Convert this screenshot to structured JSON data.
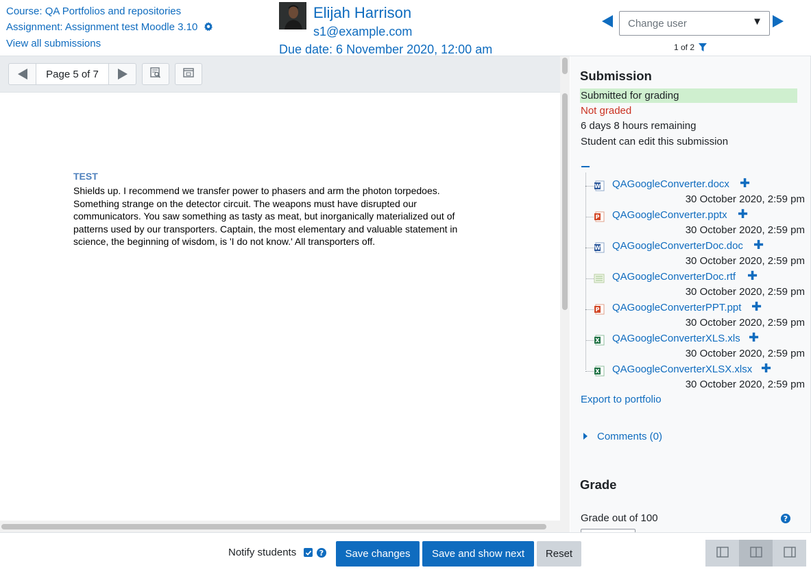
{
  "header": {
    "course_link": "Course: QA Portfolios and repositories",
    "assignment_link": "Assignment: Assignment test Moodle 3.10",
    "view_all": "View all submissions",
    "user_name": "Elijah Harrison",
    "user_email": "s1@example.com",
    "due_date": "Due date: 6 November 2020, 12:00 am",
    "change_user_placeholder": "Change user",
    "user_count": "1 of 2"
  },
  "review": {
    "page_indicator": "Page 5 of 7",
    "doc_title": "TEST",
    "doc_text": "Shields up. I recommend we transfer power to phasers and arm the photon torpedoes. Something strange on the detector circuit. The weapons must have disrupted our communicators. You saw something as tasty as meat, but inorganically materialized out of patterns used by our transporters. Captain, the most elementary and valuable statement in science, the beginning of wisdom, is 'I do not know.' All transporters off."
  },
  "submission": {
    "heading": "Submission",
    "status_submitted": "Submitted for grading",
    "status_grading": "Not graded",
    "time_remaining": "6 days 8 hours remaining",
    "edit_status": "Student can edit this submission",
    "files": [
      {
        "name": "QAGoogleConverter.docx",
        "date": "30 October 2020, 2:59 pm",
        "icon": "word-icon"
      },
      {
        "name": "QAGoogleConverter.pptx",
        "date": "30 October 2020, 2:59 pm",
        "icon": "powerpoint-icon"
      },
      {
        "name": "QAGoogleConverterDoc.doc",
        "date": "30 October 2020, 2:59 pm",
        "icon": "word-icon"
      },
      {
        "name": "QAGoogleConverterDoc.rtf",
        "date": "30 October 2020, 2:59 pm",
        "icon": "text-document-icon"
      },
      {
        "name": "QAGoogleConverterPPT.ppt",
        "date": "30 October 2020, 2:59 pm",
        "icon": "powerpoint-icon"
      },
      {
        "name": "QAGoogleConverterXLS.xls",
        "date": "30 October 2020, 2:59 pm",
        "icon": "excel-icon"
      },
      {
        "name": "QAGoogleConverterXLSX.xlsx",
        "date": "30 October 2020, 2:59 pm",
        "icon": "excel-icon"
      }
    ],
    "export_link": "Export to portfolio",
    "comments_link": "Comments (0)"
  },
  "grade": {
    "heading": "Grade",
    "grade_out_of": "Grade out of 100"
  },
  "footer": {
    "notify_label": "Notify students",
    "notify_checked": true,
    "save_changes": "Save changes",
    "save_and_next": "Save and show next",
    "reset": "Reset"
  },
  "colors": {
    "link": "#0f6cbf",
    "success_bg": "#cfefcf",
    "danger": "#ca3120"
  }
}
